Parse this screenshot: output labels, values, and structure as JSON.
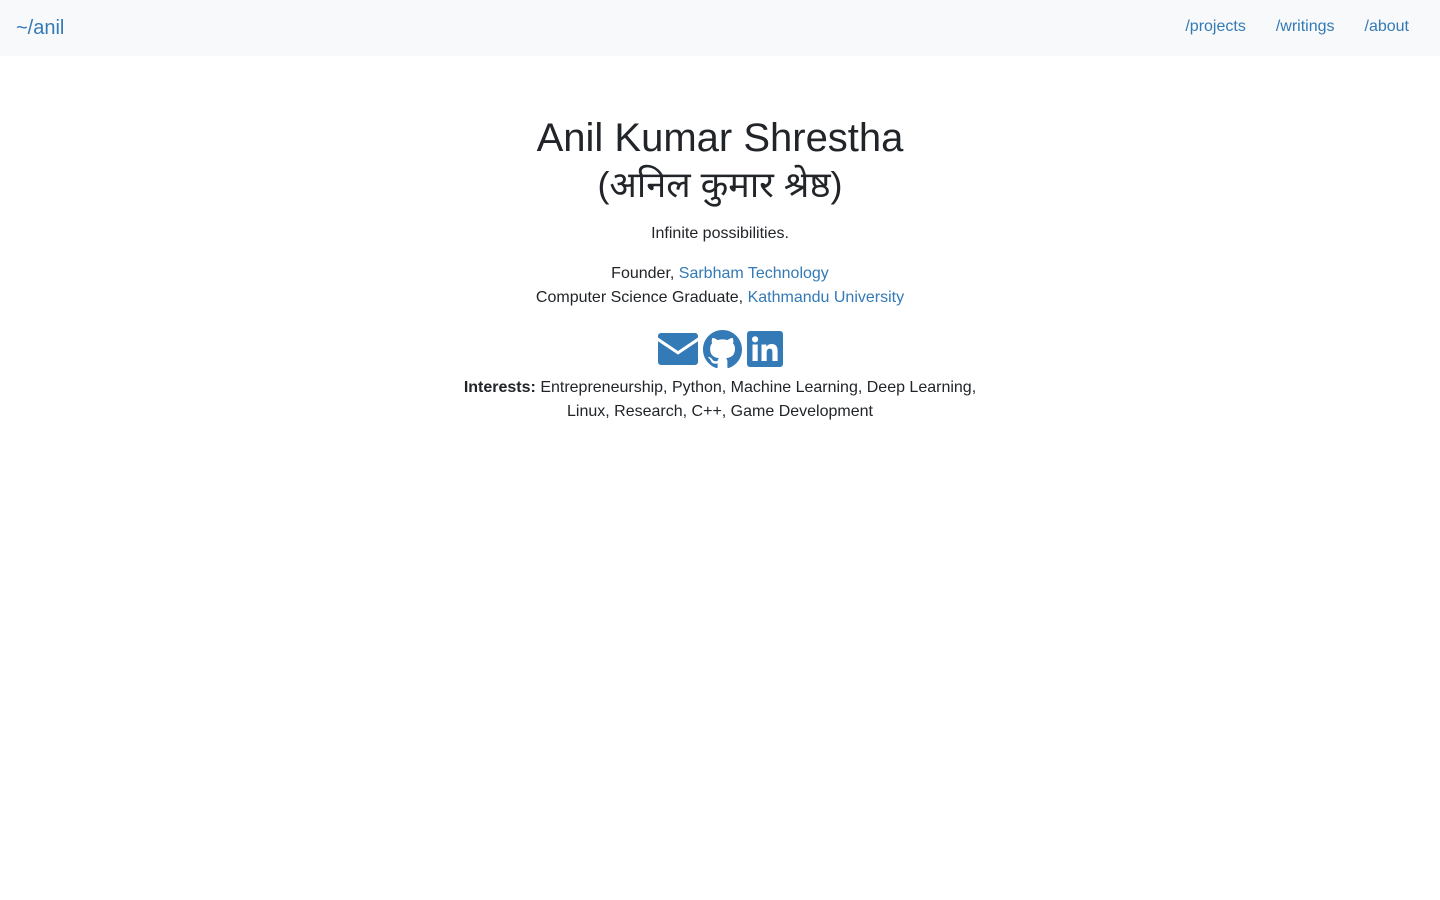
{
  "nav": {
    "brand": "~/anil",
    "links": [
      "/projects",
      "/writings",
      "/about"
    ]
  },
  "profile": {
    "name": "Anil Kumar Shrestha",
    "native_name": "(अनिल कुमार श्रेष्ठ)",
    "tagline": "Infinite possibilities.",
    "role1_prefix": "Founder, ",
    "role1_org": "Sarbham Technology",
    "role2_prefix": "Computer Science Graduate, ",
    "role2_org": "Kathmandu University",
    "socials": [
      "envelope-icon",
      "github-icon",
      "linkedin-icon"
    ],
    "interests_label": "Interests:",
    "interests_text": "Entrepreneurship, Python, Machine Learning, Deep Learning, Linux, Research, C++, Game Development"
  },
  "colors": {
    "link": "#337ab7",
    "text": "#212529",
    "navbar_bg": "#f8f9fa"
  }
}
